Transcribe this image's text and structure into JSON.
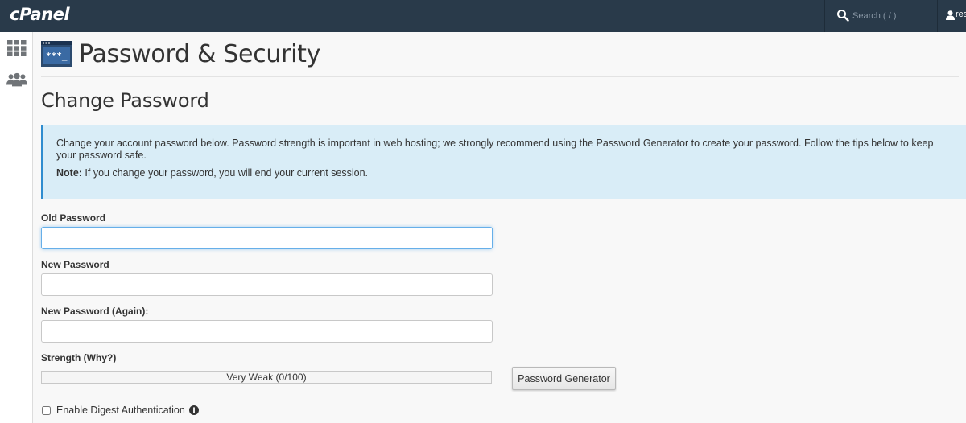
{
  "app": {
    "logo_text": "cPanel",
    "search_placeholder": "Search ( / )",
    "user_label": "res"
  },
  "sidebar": {
    "items": [
      {
        "icon": "grid-icon",
        "label": "Home"
      },
      {
        "icon": "users-icon",
        "label": "Users"
      }
    ]
  },
  "page": {
    "title": "Password & Security",
    "section_title": "Change Password"
  },
  "callout": {
    "text": "Change your account password below. Password strength is important in web hosting; we strongly recommend using the Password Generator to create your password. Follow the tips below to keep your password safe.",
    "note_label": "Note:",
    "note_text": " If you change your password, you will end your current session."
  },
  "form": {
    "old_password_label": "Old Password",
    "old_password_value": "",
    "new_password_label": "New Password",
    "new_password_value": "",
    "new_password_again_label": "New Password (Again):",
    "new_password_again_value": "",
    "strength_label": "Strength (Why?)",
    "strength_text": "Very Weak (0/100)",
    "strength_value": 0,
    "generator_button": "Password Generator",
    "digest_label": "Enable Digest Authentication",
    "digest_checked": false
  },
  "colors": {
    "topbar": "#293a4a",
    "callout_bg": "#d9edf7",
    "callout_border": "#2e8ccf",
    "focus_border": "#66afe9"
  }
}
